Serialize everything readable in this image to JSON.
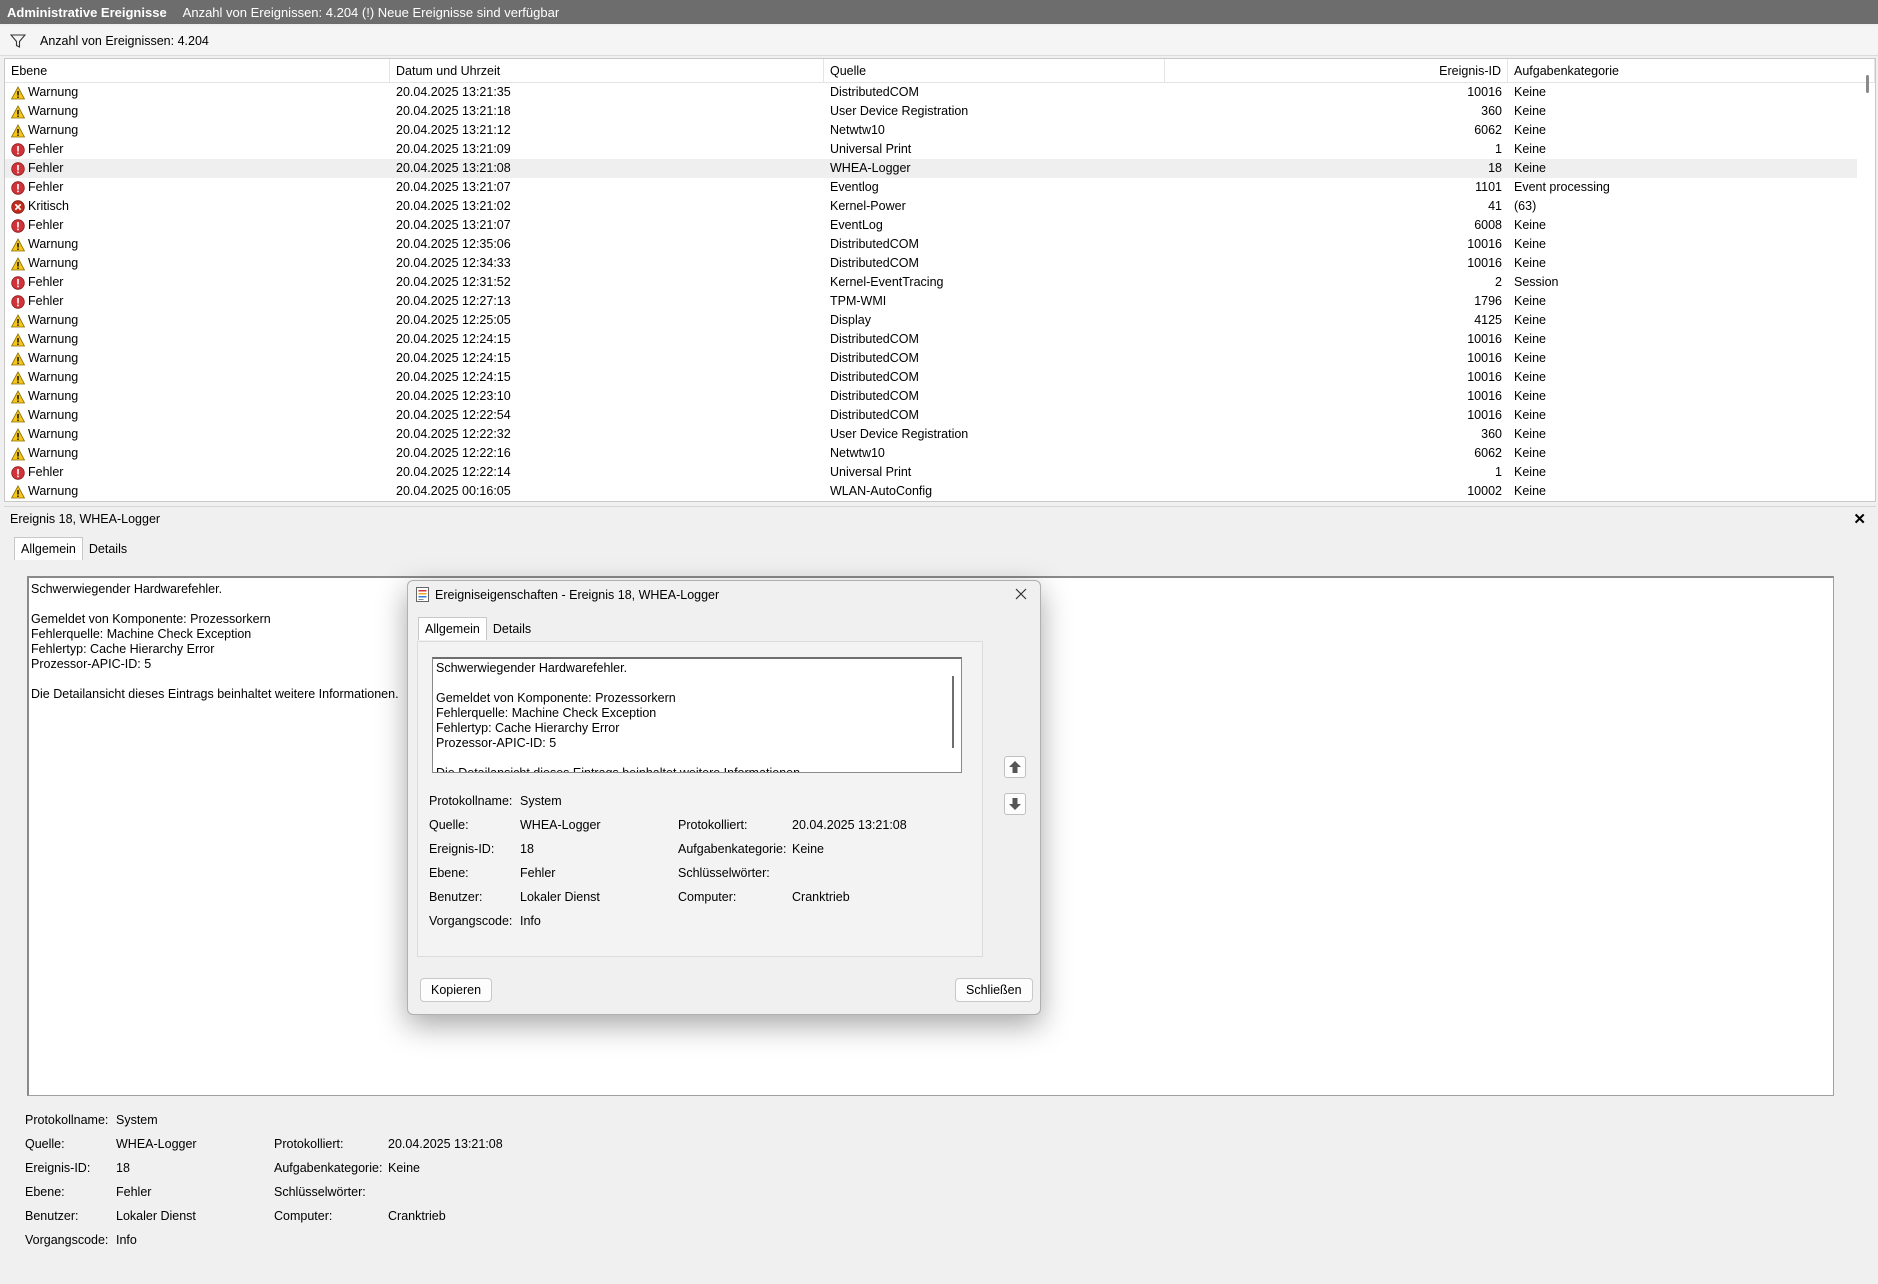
{
  "title_bar": {
    "title": "Administrative Ereignisse",
    "info": "Anzahl von Ereignissen: 4.204 (!) Neue Ereignisse sind verfügbar"
  },
  "filter_bar": {
    "count_text": "Anzahl von Ereignissen: 4.204"
  },
  "columns": {
    "level": "Ebene",
    "date": "Datum und Uhrzeit",
    "source": "Quelle",
    "id": "Ereignis-ID",
    "task": "Aufgabenkategorie"
  },
  "events": [
    {
      "level": "Warnung",
      "type": "warning",
      "date": "20.04.2025 13:21:35",
      "source": "DistributedCOM",
      "id": "10016",
      "task": "Keine"
    },
    {
      "level": "Warnung",
      "type": "warning",
      "date": "20.04.2025 13:21:18",
      "source": "User Device Registration",
      "id": "360",
      "task": "Keine"
    },
    {
      "level": "Warnung",
      "type": "warning",
      "date": "20.04.2025 13:21:12",
      "source": "Netwtw10",
      "id": "6062",
      "task": "Keine"
    },
    {
      "level": "Fehler",
      "type": "error",
      "date": "20.04.2025 13:21:09",
      "source": "Universal Print",
      "id": "1",
      "task": "Keine"
    },
    {
      "level": "Fehler",
      "type": "error",
      "date": "20.04.2025 13:21:08",
      "source": "WHEA-Logger",
      "id": "18",
      "task": "Keine",
      "selected": true
    },
    {
      "level": "Fehler",
      "type": "error",
      "date": "20.04.2025 13:21:07",
      "source": "Eventlog",
      "id": "1101",
      "task": "Event processing"
    },
    {
      "level": "Kritisch",
      "type": "critical",
      "date": "20.04.2025 13:21:02",
      "source": "Kernel-Power",
      "id": "41",
      "task": "(63)"
    },
    {
      "level": "Fehler",
      "type": "error",
      "date": "20.04.2025 13:21:07",
      "source": "EventLog",
      "id": "6008",
      "task": "Keine"
    },
    {
      "level": "Warnung",
      "type": "warning",
      "date": "20.04.2025 12:35:06",
      "source": "DistributedCOM",
      "id": "10016",
      "task": "Keine"
    },
    {
      "level": "Warnung",
      "type": "warning",
      "date": "20.04.2025 12:34:33",
      "source": "DistributedCOM",
      "id": "10016",
      "task": "Keine"
    },
    {
      "level": "Fehler",
      "type": "error",
      "date": "20.04.2025 12:31:52",
      "source": "Kernel-EventTracing",
      "id": "2",
      "task": "Session"
    },
    {
      "level": "Fehler",
      "type": "error",
      "date": "20.04.2025 12:27:13",
      "source": "TPM-WMI",
      "id": "1796",
      "task": "Keine"
    },
    {
      "level": "Warnung",
      "type": "warning",
      "date": "20.04.2025 12:25:05",
      "source": "Display",
      "id": "4125",
      "task": "Keine"
    },
    {
      "level": "Warnung",
      "type": "warning",
      "date": "20.04.2025 12:24:15",
      "source": "DistributedCOM",
      "id": "10016",
      "task": "Keine"
    },
    {
      "level": "Warnung",
      "type": "warning",
      "date": "20.04.2025 12:24:15",
      "source": "DistributedCOM",
      "id": "10016",
      "task": "Keine"
    },
    {
      "level": "Warnung",
      "type": "warning",
      "date": "20.04.2025 12:24:15",
      "source": "DistributedCOM",
      "id": "10016",
      "task": "Keine"
    },
    {
      "level": "Warnung",
      "type": "warning",
      "date": "20.04.2025 12:23:10",
      "source": "DistributedCOM",
      "id": "10016",
      "task": "Keine"
    },
    {
      "level": "Warnung",
      "type": "warning",
      "date": "20.04.2025 12:22:54",
      "source": "DistributedCOM",
      "id": "10016",
      "task": "Keine"
    },
    {
      "level": "Warnung",
      "type": "warning",
      "date": "20.04.2025 12:22:32",
      "source": "User Device Registration",
      "id": "360",
      "task": "Keine"
    },
    {
      "level": "Warnung",
      "type": "warning",
      "date": "20.04.2025 12:22:16",
      "source": "Netwtw10",
      "id": "6062",
      "task": "Keine"
    },
    {
      "level": "Fehler",
      "type": "error",
      "date": "20.04.2025 12:22:14",
      "source": "Universal Print",
      "id": "1",
      "task": "Keine"
    },
    {
      "level": "Warnung",
      "type": "warning",
      "date": "20.04.2025 00:16:05",
      "source": "WLAN-AutoConfig",
      "id": "10002",
      "task": "Keine"
    }
  ],
  "detail": {
    "header": "Ereignis 18, WHEA-Logger",
    "tab_general": "Allgemein",
    "tab_details": "Details",
    "message": "Schwerwiegender Hardwarefehler.\n\nGemeldet von Komponente: Prozessorkern\nFehlerquelle: Machine Check Exception\nFehlertyp: Cache Hierarchy Error\nProzessor-APIC-ID: 5\n\nDie Detailansicht dieses Eintrags beinhaltet weitere Informationen.",
    "props": {
      "log_name_label": "Protokollname:",
      "log_name": "System",
      "source_label": "Quelle:",
      "source": "WHEA-Logger",
      "logged_label": "Protokolliert:",
      "logged": "20.04.2025 13:21:08",
      "event_id_label": "Ereignis-ID:",
      "event_id": "18",
      "task_label": "Aufgabenkategorie:",
      "task": "Keine",
      "level_label": "Ebene:",
      "level": "Fehler",
      "keywords_label": "Schlüsselwörter:",
      "keywords": "",
      "user_label": "Benutzer:",
      "user": "Lokaler Dienst",
      "computer_label": "Computer:",
      "computer": "Cranktrieb",
      "opcode_label": "Vorgangscode:",
      "opcode": "Info"
    }
  },
  "dialog": {
    "title": "Ereigniseigenschaften - Ereignis 18, WHEA-Logger",
    "tab_general": "Allgemein",
    "tab_details": "Details",
    "copy_label": "Kopieren",
    "close_label": "Schließen"
  },
  "colors": {
    "title_bar": "#6d6d6d",
    "warning": "#f5c518",
    "error": "#d13438",
    "critical": "#c42b1c"
  }
}
